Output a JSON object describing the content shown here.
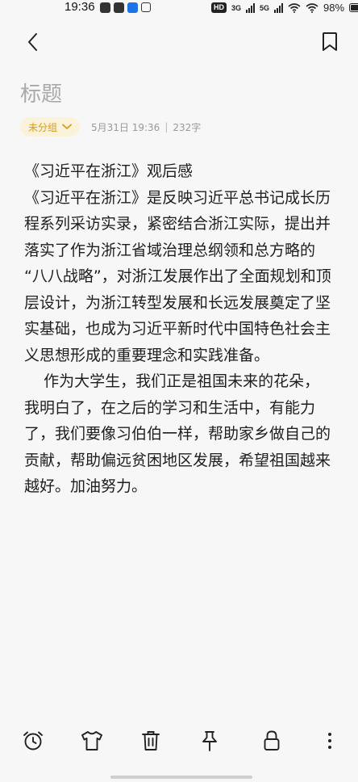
{
  "status_bar": {
    "time": "19:36",
    "hd": "HD",
    "net1": "3G",
    "net2": "5G",
    "battery": "98%",
    "battery_level": 0.98
  },
  "nav": {
    "back_icon": "chevron-left-icon",
    "bookmark_icon": "bookmark-icon"
  },
  "note": {
    "title_placeholder": "标题",
    "group": "未分组",
    "date": "5月31日 19:36",
    "separator": "|",
    "word_count": "232字",
    "lines": [
      "《习近平在浙江》观后感",
      "《习近平在浙江》是反映习近平总书记成长历",
      "程系列采访实录，紧密结合浙江实际，提出并",
      "落实了作为浙江省域治理总纲领和总方略的",
      "“八八战略”，对浙江发展作出了全面规划和顶",
      "层设计，为浙江转型发展和长远发展奠定了坚",
      "实基础，也成为习近平新时代中国特色社会主",
      "义思想形成的重要理念和实践准备。",
      "    作为大学生，我们正是祖国未来的花朵，",
      "我明白了，在之后的学习和生活中，有能力",
      "了，我们要像习伯伯一样，帮助家乡做自己的",
      "贡献，帮助偏远贫困地区发展，希望祖国越来",
      "越好。加油努力。"
    ]
  },
  "toolbar": {
    "icons": [
      "alarm-clock-icon",
      "tshirt-icon",
      "trash-icon",
      "pin-icon",
      "lock-icon",
      "more-vertical-icon"
    ]
  },
  "colors": {
    "background": "#f7f7f7",
    "accent": "#d99a16",
    "chip_bg": "#fbf2dc",
    "title_gray": "#aaaaaa"
  }
}
